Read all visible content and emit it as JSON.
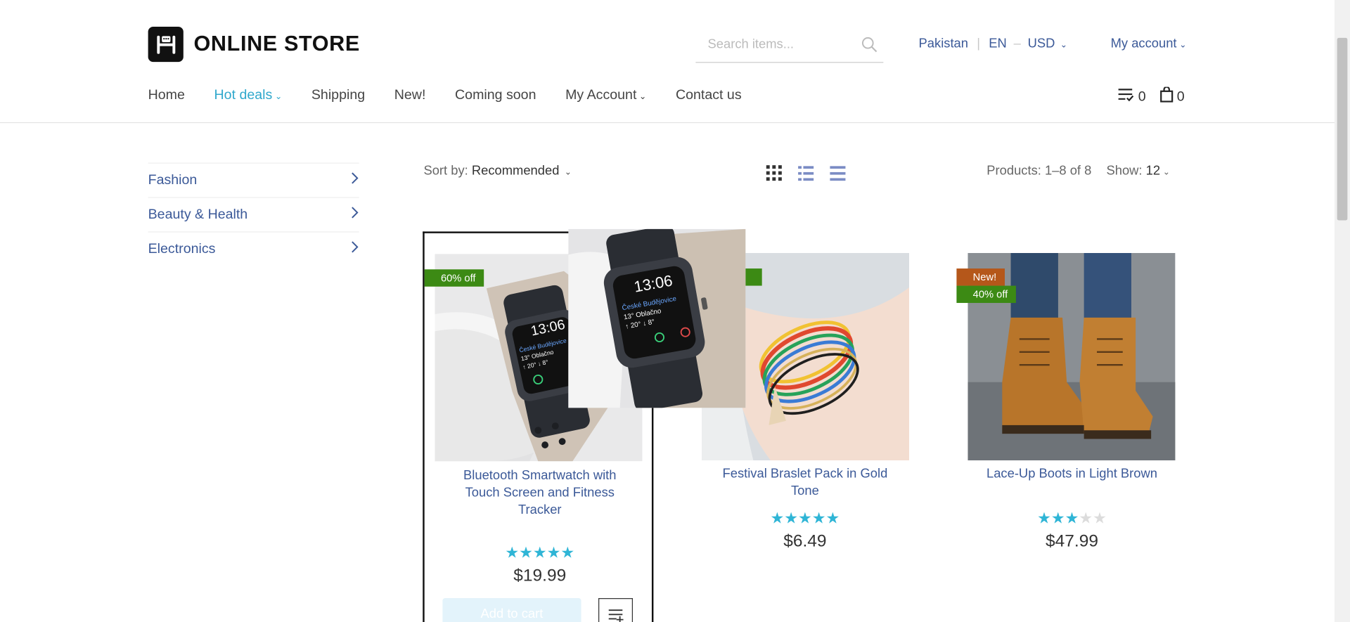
{
  "header": {
    "logo_text": "ONLINE STORE",
    "search_placeholder": "Search items...",
    "country": "Pakistan",
    "language": "EN",
    "currency": "USD",
    "account": "My account"
  },
  "nav": {
    "items": [
      {
        "label": "Home",
        "active": false
      },
      {
        "label": "Hot deals",
        "active": true,
        "dropdown": true
      },
      {
        "label": "Shipping"
      },
      {
        "label": "New!"
      },
      {
        "label": "Coming soon"
      },
      {
        "label": "My Account",
        "dropdown": true
      },
      {
        "label": "Contact us"
      }
    ],
    "wishlist_count": "0",
    "cart_count": "0"
  },
  "sidebar": {
    "categories": [
      "Fashion",
      "Beauty & Health",
      "Electronics"
    ]
  },
  "toolbar": {
    "sort_label": "Sort by:",
    "sort_value": "Recommended",
    "products_count": "Products: 1–8 of 8",
    "show_label": "Show:",
    "show_value": "12"
  },
  "products": [
    {
      "title": "Bluetooth Smartwatch with Touch Screen and Fitness Tracker",
      "badges": [
        "60% off"
      ],
      "rating": 5,
      "price": "$19.99",
      "add_to_cart": "Add to cart"
    },
    {
      "title": "Festival Braslet Pack in Gold Tone",
      "badges": [],
      "rating": 5,
      "price": "$6.49"
    },
    {
      "title": "Lace-Up Boots in Light Brown",
      "badges": [
        "New!",
        "40% off"
      ],
      "rating": 3,
      "price": "$47.99"
    }
  ],
  "colors": {
    "accent": "#2fa8cc",
    "link": "#3b5998",
    "badge_green": "#3c8a14",
    "badge_orange": "#b5571a"
  }
}
